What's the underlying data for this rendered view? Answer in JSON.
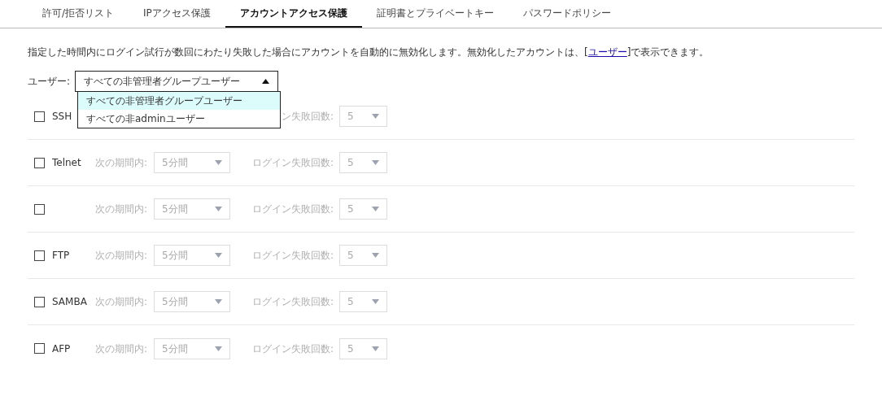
{
  "tabs": [
    {
      "label": "許可/拒否リスト",
      "selected": false
    },
    {
      "label": "IPアクセス保護",
      "selected": false
    },
    {
      "label": "アカウントアクセス保護",
      "selected": true
    },
    {
      "label": "証明書とプライベートキー",
      "selected": false
    },
    {
      "label": "パスワードポリシー",
      "selected": false
    }
  ],
  "description": {
    "before": "指定した時間内にログイン試行が数回にわたり失敗した場合にアカウントを自動的に無効化します。無効化したアカウントは、[",
    "link": "ユーザー",
    "after": "]で表示できます。"
  },
  "user_select": {
    "label": "ユーザー:",
    "value": "すべての非管理者グループユーザー",
    "expanded": true,
    "options": [
      {
        "label": "すべての非管理者グループユーザー",
        "selected": true
      },
      {
        "label": "すべての非adminユーザー",
        "selected": false
      }
    ]
  },
  "services": [
    {
      "name": "SSH",
      "checked": false,
      "attempts_label": "ン失敗回数:",
      "attempts": "5",
      "disabled": true
    },
    {
      "name": "Telnet",
      "checked": false,
      "period_label": "次の期間内:",
      "period": "5分間",
      "attempts_label": "ログイン失敗回数:",
      "attempts": "5",
      "disabled": true
    },
    {
      "checked": false,
      "period_label": "次の期間内:",
      "period": "5分間",
      "attempts_label": "ログイン失敗回数:",
      "attempts": "5",
      "disabled": true
    },
    {
      "name": "FTP",
      "checked": false,
      "period_label": "次の期間内:",
      "period": "5分間",
      "attempts_label": "ログイン失敗回数:",
      "attempts": "5",
      "disabled": true
    },
    {
      "name": "SAMBA",
      "checked": false,
      "period_label": "次の期間内:",
      "period": "5分間",
      "attempts_label": "ログイン失敗回数:",
      "attempts": "5",
      "disabled": true
    },
    {
      "name": "AFP",
      "checked": false,
      "period_label": "次の期間内:",
      "period": "5分間",
      "attempts_label": "ログイン失敗回数:",
      "attempts": "5",
      "disabled": true
    }
  ]
}
